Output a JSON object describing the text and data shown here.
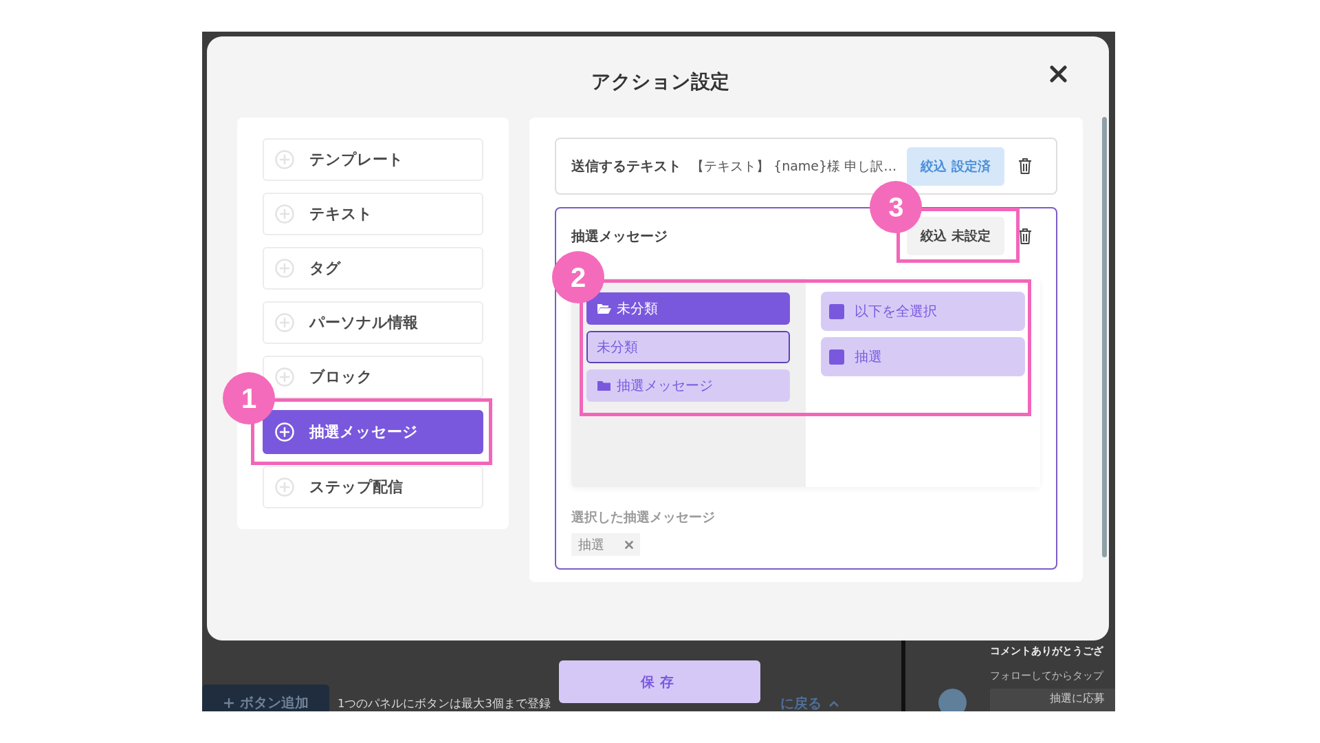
{
  "dialog": {
    "title": "アクション設定",
    "save_button": "保存"
  },
  "action_types": [
    {
      "label": "テンプレート",
      "selected": false
    },
    {
      "label": "テキスト",
      "selected": false
    },
    {
      "label": "タグ",
      "selected": false
    },
    {
      "label": "パーソナル情報",
      "selected": false
    },
    {
      "label": "ブロック",
      "selected": false
    },
    {
      "label": "抽選メッセージ",
      "selected": true
    },
    {
      "label": "ステップ配信",
      "selected": false
    }
  ],
  "actions": [
    {
      "kind": "text",
      "selected": false,
      "title": "送信するテキスト",
      "summary": "【テキスト】 {name}様 申し訳…",
      "filter": {
        "label": "絞込 設定済",
        "set": true
      }
    },
    {
      "kind": "lottery",
      "selected": true,
      "title": "抽選メッセージ",
      "filter": {
        "label": "絞込 未設定",
        "set": false
      },
      "folders": [
        {
          "kind": "folder",
          "label": "未分類",
          "expanded": true,
          "selected": false
        },
        {
          "kind": "category",
          "label": "未分類",
          "selected": true
        },
        {
          "kind": "folder",
          "label": "抽選メッセージ",
          "expanded": false,
          "selected": false
        }
      ],
      "messages": [
        {
          "label": "以下を全選択",
          "checked": true
        },
        {
          "label": "抽選",
          "checked": true
        }
      ],
      "selected_heading": "選択した抽選メッセージ",
      "selected_messages": [
        {
          "label": "抽選"
        }
      ]
    }
  ],
  "annotations": [
    {
      "label": "1"
    },
    {
      "label": "2"
    },
    {
      "label": "3"
    }
  ],
  "background_page": {
    "add_button": "ボタン追加",
    "notice": "1つのパネルにボタンは最大3個まで登録",
    "back_link": "に戻る",
    "preview": {
      "lines": [
        "コメントありがとうござ",
        "フォローしてからタップ"
      ],
      "button": "抽選に応募"
    }
  }
}
